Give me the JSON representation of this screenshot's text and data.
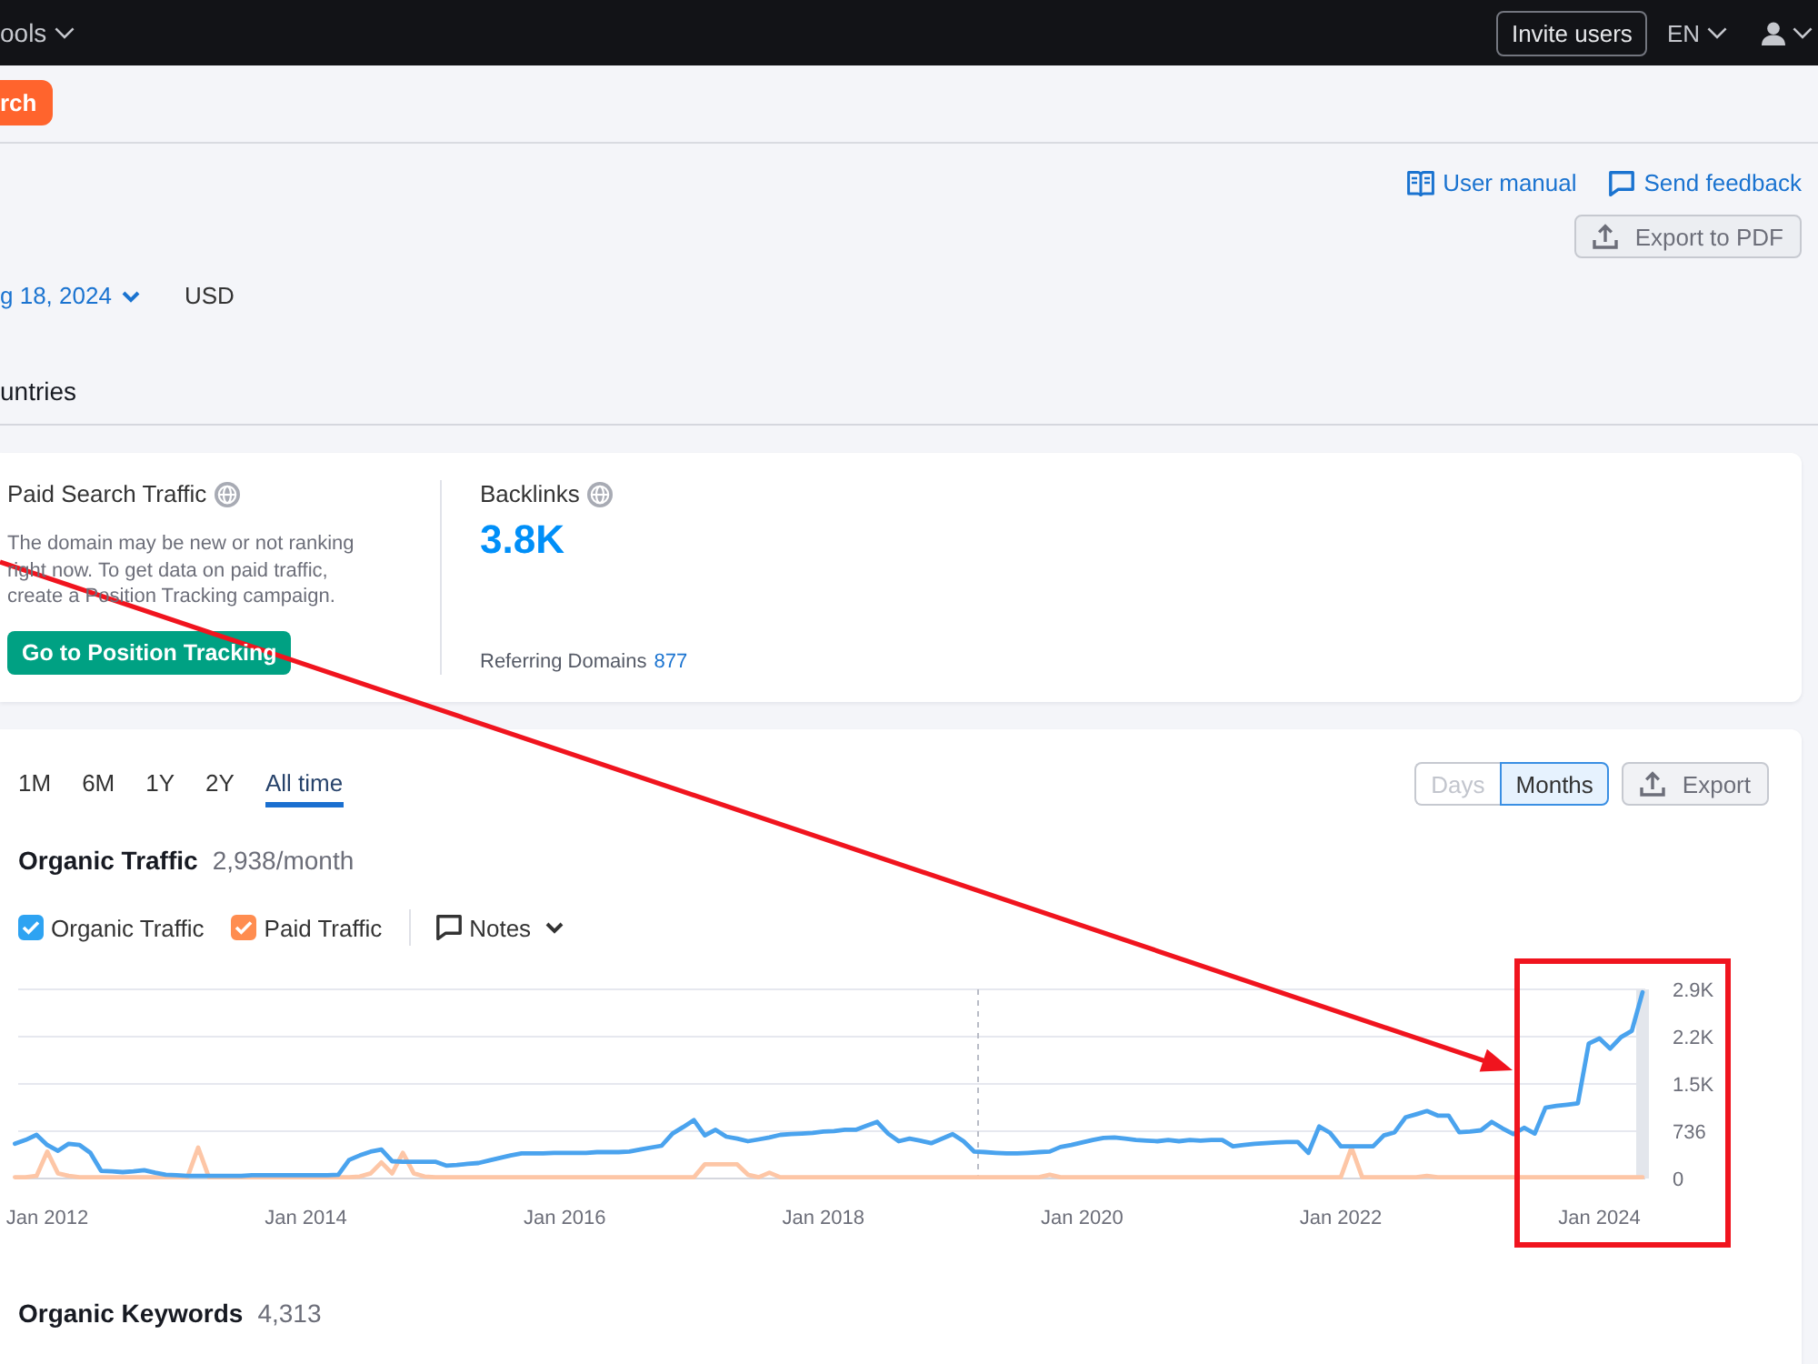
{
  "top_bar": {
    "menu": "ools",
    "invite_button": "Invite users",
    "language": "EN"
  },
  "toolbar": {
    "search_button": "rch"
  },
  "header": {
    "links": [
      {
        "kind": "manual",
        "label": "User manual"
      },
      {
        "kind": "feedback",
        "label": "Send feedback"
      }
    ],
    "export_button": "Export to PDF",
    "date": "g 18, 2024",
    "currency": "USD",
    "tab": "untries"
  },
  "paid_search": {
    "title": "Paid Search Traffic",
    "description": "The domain may be new or not ranking right now. To get data on paid traffic, create a Position Tracking campaign.",
    "button": "Go to Position Tracking"
  },
  "backlinks": {
    "title": "Backlinks",
    "value": "3.8K",
    "referring_label": "Referring Domains",
    "referring_value": "877"
  },
  "traffic": {
    "periods": [
      {
        "label": "1M",
        "selected": false
      },
      {
        "label": "6M",
        "selected": false
      },
      {
        "label": "1Y",
        "selected": false
      },
      {
        "label": "2Y",
        "selected": false
      },
      {
        "label": "All time",
        "selected": true
      }
    ],
    "granularity": [
      {
        "label": "Days",
        "selected": false,
        "disabled": true
      },
      {
        "label": "Months",
        "selected": true,
        "disabled": false
      }
    ],
    "export_button": "Export",
    "title": "Organic Traffic",
    "value": "2,938/month",
    "legend": [
      {
        "checked": true,
        "color": "#2ea3f2"
      },
      {
        "checked": true,
        "color": "#ff8d50"
      }
    ],
    "notes_button": "Notes",
    "chart_data": {
      "type": "line",
      "grid": true,
      "categories": [
        null,
        null,
        null,
        "Jan 2012",
        null,
        null,
        null,
        null,
        null,
        null,
        null,
        null,
        null,
        null,
        null,
        null,
        null,
        null,
        null,
        null,
        null,
        null,
        null,
        null,
        null,
        null,
        null,
        "Jan 2014",
        null,
        null,
        null,
        null,
        null,
        null,
        null,
        null,
        null,
        null,
        null,
        null,
        null,
        null,
        null,
        null,
        null,
        null,
        null,
        null,
        null,
        null,
        null,
        "Jan 2016",
        null,
        null,
        null,
        null,
        null,
        null,
        null,
        null,
        null,
        null,
        null,
        null,
        null,
        null,
        null,
        null,
        null,
        null,
        null,
        null,
        null,
        null,
        null,
        "Jan 2018",
        null,
        null,
        null,
        null,
        null,
        null,
        null,
        null,
        null,
        null,
        null,
        null,
        null,
        null,
        null,
        null,
        null,
        null,
        null,
        null,
        null,
        null,
        null,
        "Jan 2020",
        null,
        null,
        null,
        null,
        null,
        null,
        null,
        null,
        null,
        null,
        null,
        null,
        null,
        null,
        null,
        null,
        null,
        null,
        null,
        null,
        null,
        null,
        null,
        "Jan 2022",
        null,
        null,
        null,
        null,
        null,
        null,
        null,
        null,
        null,
        null,
        null,
        null,
        null,
        null,
        null,
        null,
        null,
        null,
        null,
        null,
        null,
        null,
        null,
        "Jan 2024",
        null,
        null,
        null,
        null
      ],
      "series": [
        {
          "name": "Organic Traffic",
          "color": "#4aa3ee",
          "values": [
            540,
            600,
            680,
            520,
            430,
            540,
            520,
            400,
            120,
            110,
            100,
            110,
            130,
            90,
            60,
            50,
            40,
            40,
            40,
            40,
            40,
            40,
            50,
            50,
            50,
            50,
            50,
            50,
            50,
            50,
            60,
            290,
            360,
            420,
            450,
            270,
            260,
            260,
            260,
            260,
            200,
            210,
            230,
            240,
            280,
            320,
            360,
            390,
            390,
            390,
            400,
            400,
            400,
            400,
            410,
            410,
            410,
            420,
            450,
            480,
            510,
            700,
            800,
            910,
            670,
            760,
            650,
            620,
            580,
            610,
            640,
            680,
            690,
            700,
            710,
            730,
            740,
            760,
            760,
            820,
            880,
            700,
            580,
            620,
            590,
            550,
            620,
            690,
            580,
            420,
            410,
            400,
            390,
            390,
            400,
            410,
            420,
            490,
            520,
            560,
            600,
            630,
            640,
            620,
            600,
            590,
            580,
            600,
            580,
            600,
            590,
            600,
            600,
            500,
            520,
            540,
            550,
            560,
            570,
            570,
            400,
            810,
            710,
            500,
            500,
            500,
            500,
            670,
            720,
            950,
            1000,
            1050,
            980,
            980,
            720,
            730,
            750,
            880,
            780,
            690,
            790,
            700,
            1100,
            1130,
            1150,
            1170,
            2100,
            2180,
            2020,
            2200,
            2300,
            2900
          ]
        },
        {
          "name": "Paid Traffic",
          "color": "#fdc6a6",
          "values": [
            20,
            20,
            40,
            420,
            80,
            40,
            20,
            20,
            20,
            20,
            20,
            20,
            20,
            20,
            20,
            20,
            20,
            480,
            20,
            20,
            20,
            20,
            20,
            20,
            20,
            20,
            20,
            20,
            20,
            20,
            20,
            20,
            30,
            80,
            250,
            80,
            400,
            80,
            30,
            20,
            20,
            20,
            20,
            20,
            20,
            20,
            20,
            20,
            20,
            20,
            20,
            20,
            20,
            20,
            20,
            20,
            20,
            20,
            20,
            20,
            20,
            20,
            20,
            20,
            220,
            220,
            220,
            220,
            60,
            20,
            90,
            20,
            20,
            20,
            20,
            20,
            20,
            20,
            20,
            20,
            20,
            20,
            20,
            20,
            20,
            20,
            20,
            20,
            20,
            20,
            20,
            20,
            20,
            20,
            20,
            20,
            60,
            20,
            20,
            20,
            20,
            20,
            20,
            20,
            20,
            20,
            20,
            20,
            20,
            20,
            20,
            20,
            20,
            20,
            20,
            20,
            20,
            20,
            20,
            20,
            20,
            20,
            20,
            20,
            480,
            20,
            20,
            20,
            20,
            20,
            20,
            40,
            20,
            20,
            20,
            20,
            20,
            20,
            20,
            20,
            20,
            20,
            20,
            20,
            20,
            20,
            20,
            20,
            20,
            20,
            20,
            20
          ]
        }
      ],
      "ylim": [
        0,
        2944
      ],
      "yticks": [
        {
          "value": 0,
          "label": "0"
        },
        {
          "value": 736,
          "label": "736"
        },
        {
          "value": 1472,
          "label": "1.5K"
        },
        {
          "value": 2208,
          "label": "2.2K"
        },
        {
          "value": 2944,
          "label": "2.9K"
        }
      ]
    }
  },
  "keywords": {
    "title": "Organic Keywords",
    "value": "4,313"
  },
  "markup": [
    {
      "kind": "arrow"
    },
    {
      "kind": "box"
    }
  ]
}
